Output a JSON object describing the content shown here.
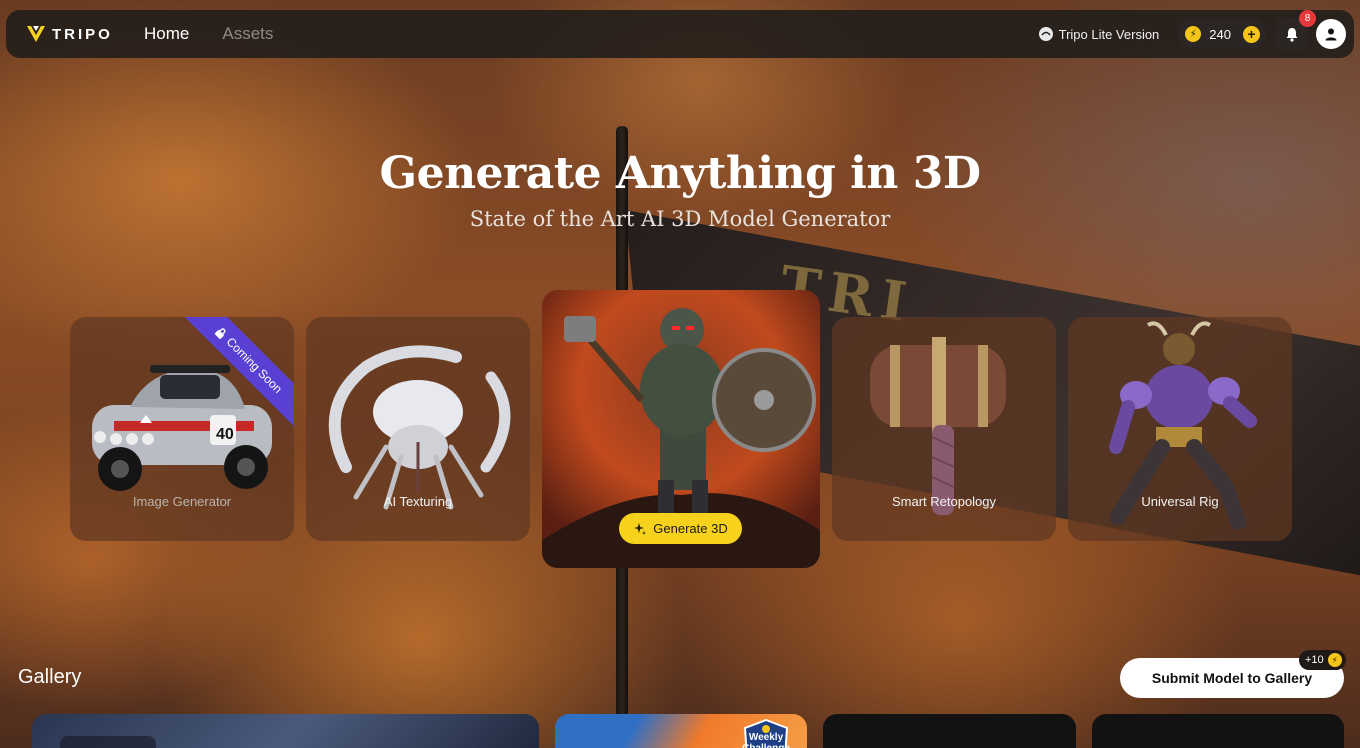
{
  "topbar": {
    "logo_text": "TRIPO",
    "nav": [
      {
        "label": "Home",
        "active": true
      },
      {
        "label": "Assets",
        "active": false
      }
    ],
    "lite_version_label": "Tripo Lite Version",
    "credits": "240",
    "notification_count": "8"
  },
  "hero": {
    "title": "Generate Anything in 3D",
    "subtitle": "State of the Art AI 3D Model Generator"
  },
  "features": [
    {
      "label": "Image Generator",
      "ribbon": "Coming Soon"
    },
    {
      "label": "AI Texturing"
    },
    {
      "label": "Generate 3D"
    },
    {
      "label": "Smart Retopology"
    },
    {
      "label": "Universal Rig"
    }
  ],
  "gallery": {
    "title": "Gallery",
    "submit_label": "Submit Model to Gallery",
    "bonus": "+10",
    "weekly_challenge_label": "Weekly Challenge"
  },
  "colors": {
    "accent_yellow": "#f6d21d",
    "ribbon_purple": "#5a3fd4",
    "badge_red": "#e5383b"
  }
}
